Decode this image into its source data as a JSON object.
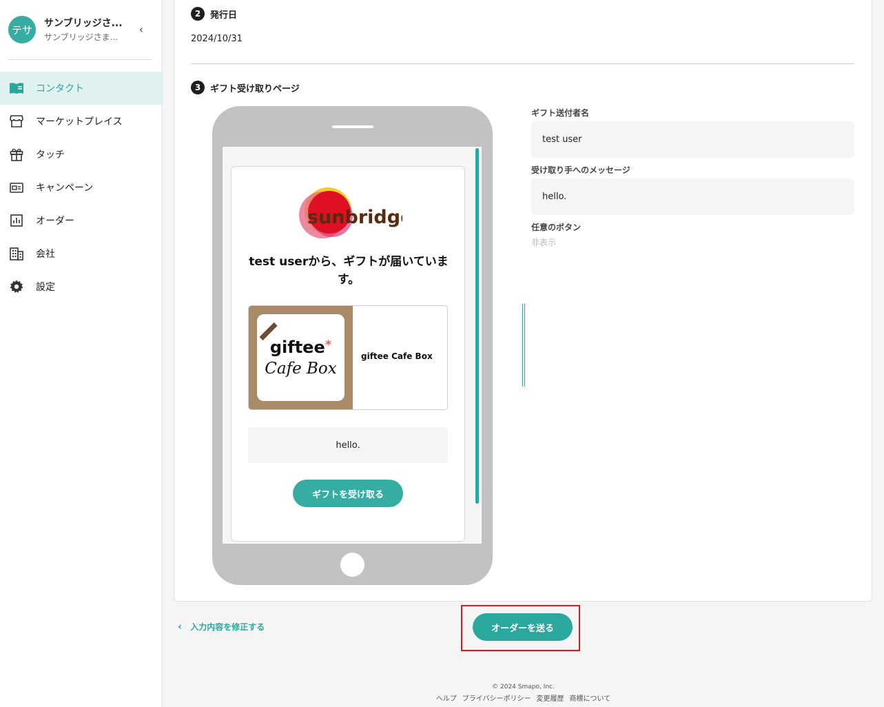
{
  "account": {
    "avatar_text": "テサ",
    "name": "サンブリッジさ...",
    "sub": "サンブリッジさま...",
    "collapse_icon": "chevron-left-icon"
  },
  "nav": {
    "items": [
      {
        "label": "コンタクト",
        "icon": "contact-book-icon",
        "active": true
      },
      {
        "label": "マーケットプレイス",
        "icon": "store-icon",
        "active": false
      },
      {
        "label": "タッチ",
        "icon": "gift-icon",
        "active": false
      },
      {
        "label": "キャンペーン",
        "icon": "campaign-icon",
        "active": false
      },
      {
        "label": "オーダー",
        "icon": "chart-icon",
        "active": false
      },
      {
        "label": "会社",
        "icon": "building-icon",
        "active": false
      },
      {
        "label": "設定",
        "icon": "gear-icon",
        "active": false
      }
    ]
  },
  "steps": {
    "issue_date": {
      "num": "2",
      "title": "発行日",
      "value": "2024/10/31"
    },
    "gift_page": {
      "num": "3",
      "title": "ギフト受け取りページ"
    }
  },
  "preview": {
    "logo_text": "sunbridge",
    "title": "test userから、ギフトが届いています。",
    "product_logo_line1": "giftee",
    "product_logo_star": "*",
    "product_logo_line2": "Cafe Box",
    "product_name": "giftee Cafe Box",
    "message": "hello.",
    "receive_button": "ギフトを受け取る"
  },
  "form": {
    "sender_label": "ギフト送付者名",
    "sender_value": "test user",
    "message_label": "受け取り手へのメッセージ",
    "message_value": "hello.",
    "button_label": "任意のボタン",
    "button_value": "非表示"
  },
  "actions": {
    "back_label": "入力内容を修正する",
    "send_label": "オーダーを送る"
  },
  "footer": {
    "copyright": "© 2024 Smapo, Inc.",
    "links": [
      "ヘルプ",
      "プライバシーポリシー",
      "変更履歴",
      "商標について"
    ]
  },
  "colors": {
    "accent": "#2aa89d",
    "highlight": "#e0141e"
  }
}
